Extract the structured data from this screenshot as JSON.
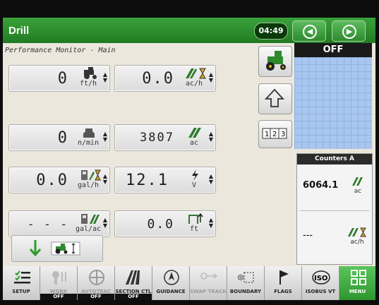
{
  "title": "Drill",
  "clock": "04:49",
  "subtitle": "Performance Monitor - Main",
  "fields": {
    "speed": {
      "value": "0",
      "unit": "ft/h"
    },
    "area_rate": {
      "value": "0.0",
      "unit": "ac/h"
    },
    "engine": {
      "value": "0",
      "unit": "n/min"
    },
    "area": {
      "value": "3807",
      "unit": "ac"
    },
    "fuel_rate": {
      "value": "0.0",
      "unit": "gal/h"
    },
    "voltage": {
      "value": "12.1",
      "unit": "V"
    },
    "fuel_per_area": {
      "value": "- - -",
      "unit": "gal/ac"
    },
    "height": {
      "value": "0.0",
      "unit": "ft"
    }
  },
  "status": "OFF",
  "counters": {
    "title": "Counters A",
    "area_value": "6064.1",
    "area_unit": "ac",
    "rate_value": "---",
    "rate_unit": "ac/h"
  },
  "toolbar": [
    {
      "label": "SETUP",
      "state": "",
      "icon": "setup-icon"
    },
    {
      "label": "WORK",
      "state": "OFF",
      "icon": "work-icon"
    },
    {
      "label": "AUTOTRAC",
      "state": "OFF",
      "icon": "autotrac-icon"
    },
    {
      "label": "SECTION CTL",
      "state": "OFF",
      "icon": "section-control-icon"
    },
    {
      "label": "GUIDANCE",
      "state": "",
      "icon": "guidance-icon"
    },
    {
      "label": "SWAP TRACK",
      "state": "",
      "icon": "swap-track-icon"
    },
    {
      "label": "BOUNDARY",
      "state": "",
      "icon": "boundary-icon"
    },
    {
      "label": "FLAGS",
      "state": "",
      "icon": "flag-icon"
    },
    {
      "label": "ISOBUS VT",
      "state": "",
      "icon": "iso-icon"
    },
    {
      "label": "MENU",
      "state": "",
      "icon": "menu-grid-icon"
    }
  ],
  "colors": {
    "accent": "#2e962e",
    "map": "#a8c6ee"
  }
}
